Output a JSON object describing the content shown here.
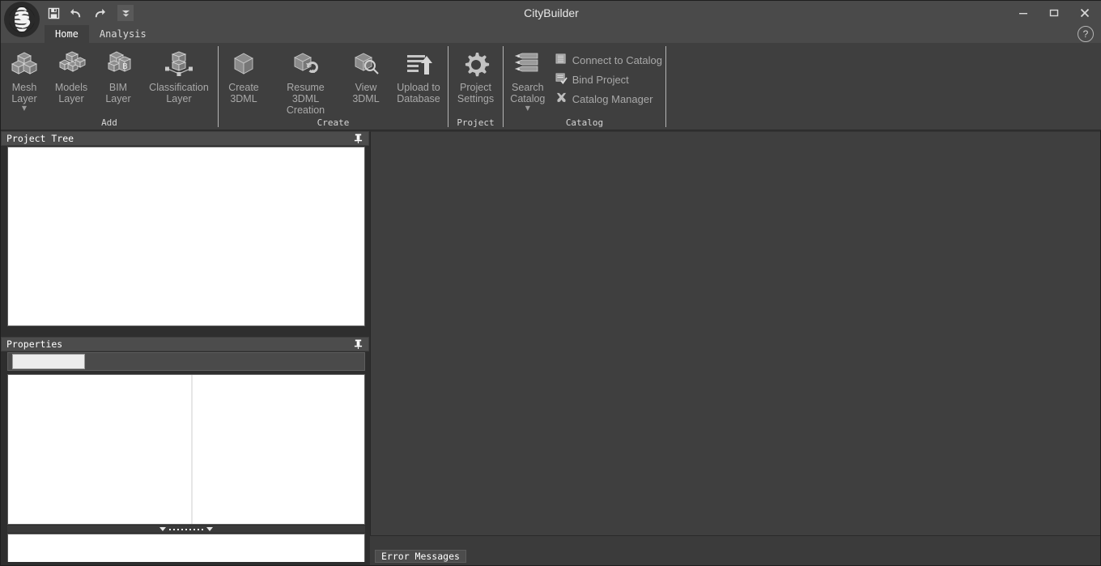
{
  "window": {
    "title": "CityBuilder",
    "logo_icon": "globe-logo-icon",
    "minimize_label": "—",
    "maximize_label": "▭",
    "close_label": "✕",
    "help_label": "?"
  },
  "quick_access": [
    {
      "name": "save-button",
      "icon": "floppy-disk-icon",
      "label": "Save"
    },
    {
      "name": "undo-button",
      "icon": "undo-arrow-icon",
      "label": "Undo"
    },
    {
      "name": "redo-button",
      "icon": "redo-arrow-icon",
      "label": "Redo"
    },
    {
      "name": "customize-qat-button",
      "icon": "chevron-down-icon",
      "label": "Customize Quick Access Toolbar"
    }
  ],
  "tabs": [
    {
      "label": "Home",
      "active": true
    },
    {
      "label": "Analysis",
      "active": false
    }
  ],
  "ribbon": {
    "groups": [
      {
        "label": "Add",
        "buttons": [
          {
            "label": "Mesh\nLayer",
            "icon": "mesh-cubes-icon",
            "has_caret": true
          },
          {
            "label": "Models\nLayer",
            "icon": "models-cubes-icon",
            "has_caret": false
          },
          {
            "label": "BIM\nLayer",
            "icon": "bim-cube-icon",
            "has_caret": false
          },
          {
            "label": "Classification\nLayer",
            "icon": "classification-cube-icon",
            "has_caret": false
          }
        ]
      },
      {
        "label": "Create",
        "buttons": [
          {
            "label": "Create\n3DML",
            "icon": "cube-icon",
            "has_caret": false
          },
          {
            "label": "Resume 3DML\nCreation",
            "icon": "cube-refresh-icon",
            "has_caret": false
          },
          {
            "label": "View\n3DML",
            "icon": "cube-magnifier-icon",
            "has_caret": false
          },
          {
            "label": "Upload to\nDatabase",
            "icon": "upload-lines-icon",
            "has_caret": false
          }
        ]
      },
      {
        "label": "Project",
        "buttons": [
          {
            "label": "Project\nSettings",
            "icon": "gear-icon",
            "has_caret": false
          }
        ]
      },
      {
        "label": "Catalog",
        "buttons": [
          {
            "label": "Search\nCatalog",
            "icon": "server-search-icon",
            "has_caret": true
          }
        ],
        "small_buttons": [
          {
            "label": "Connect to Catalog",
            "icon": "database-connect-icon"
          },
          {
            "label": "Bind Project",
            "icon": "bind-check-icon"
          },
          {
            "label": "Catalog Manager",
            "icon": "tools-cross-icon"
          }
        ]
      }
    ]
  },
  "panels": {
    "project_tree": {
      "title": "Project Tree",
      "pin_icon": "pin-icon",
      "content": ""
    },
    "properties": {
      "title": "Properties",
      "pin_icon": "pin-icon",
      "toolbar_field_value": "",
      "toolbar_field_placeholder": "",
      "grid_rows": []
    },
    "splitter": {
      "name": "horizontal-splitter",
      "up_icon": "triangle-collapse-icon"
    },
    "bottom_box": {
      "content": ""
    }
  },
  "bottom_dock": {
    "tabs": [
      {
        "label": "Error Messages",
        "active": true
      }
    ]
  },
  "colors": {
    "titlebar": "#4a4a4a",
    "ribbon": "#3f3f3f",
    "viewport": "#3f3f3f",
    "panel_header": "#4c4c4c",
    "panel_body": "#ffffff",
    "text_disabled": "#a9a9a9",
    "text_primary": "#ffffff"
  }
}
